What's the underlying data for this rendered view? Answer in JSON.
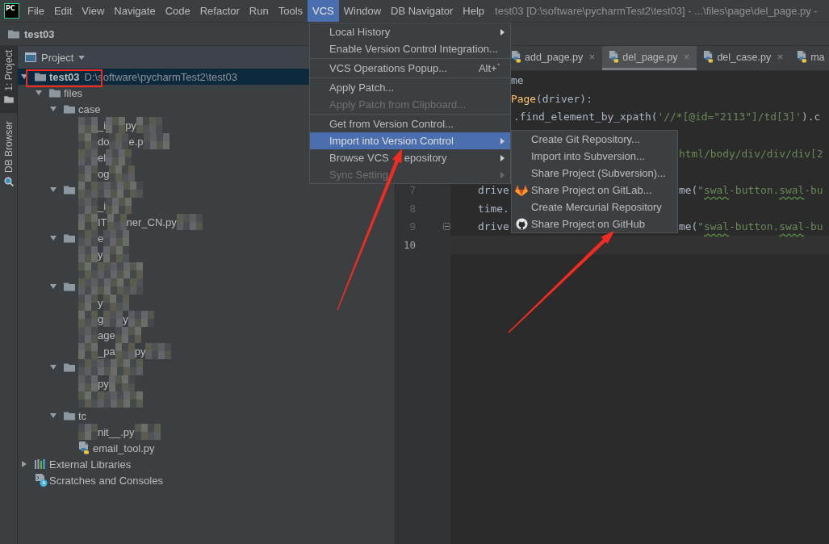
{
  "menu_bar": {
    "logo": "PC",
    "items": [
      {
        "label": "File",
        "selected": false
      },
      {
        "label": "Edit",
        "selected": false
      },
      {
        "label": "View",
        "selected": false
      },
      {
        "label": "Navigate",
        "selected": false
      },
      {
        "label": "Code",
        "selected": false
      },
      {
        "label": "Refactor",
        "selected": false
      },
      {
        "label": "Run",
        "selected": false
      },
      {
        "label": "Tools",
        "selected": false
      },
      {
        "label": "VCS",
        "selected": true
      },
      {
        "label": "Window",
        "selected": false
      },
      {
        "label": "DB Navigator",
        "selected": false
      },
      {
        "label": "Help",
        "selected": false
      }
    ],
    "title": "test03 [D:\\software\\pycharmTest2\\test03] - ...\\files\\page\\del_page.py -"
  },
  "navigation_bar": {
    "crumb": "test03"
  },
  "tool_strip": [
    {
      "label": "1: Project",
      "selected": true
    },
    {
      "label": "DB Browser",
      "selected": false
    }
  ],
  "project_panel": {
    "title": "Project",
    "tree": [
      {
        "kind": "folder",
        "name": "test03",
        "path": "D:\\software\\pycharmTest2\\test03",
        "expanded": true,
        "selected": true,
        "children": [
          {
            "kind": "folder",
            "name": "files",
            "expanded": true,
            "selected": false,
            "children": [
              {
                "kind": "folder",
                "name": "case",
                "expanded": true,
                "selected": false,
                "children": [
                  {
                    "kind": "maskedfile",
                    "fragments": [
                      "_i",
                      "py"
                    ],
                    "selected": false
                  },
                  {
                    "kind": "maskedfile",
                    "fragments": [
                      "do",
                      "e.p"
                    ],
                    "selected": false
                  },
                  {
                    "kind": "maskedfile",
                    "fragments": [
                      "el"
                    ],
                    "selected": false
                  },
                  {
                    "kind": "maskedfile",
                    "fragments": [
                      "og"
                    ],
                    "selected": false
                  }
                ]
              },
              {
                "kind": "maskedfolder",
                "expanded": true,
                "selected": false,
                "children": [
                  {
                    "kind": "maskedfile",
                    "fragments": [
                      "_i"
                    ],
                    "selected": false
                  },
                  {
                    "kind": "maskedfile",
                    "fragments": [
                      "IT",
                      "ner_CN.py"
                    ],
                    "selected": false
                  }
                ]
              },
              {
                "kind": "maskedfolder",
                "fragments": [
                  "e"
                ],
                "expanded": true,
                "selected": false,
                "children": [
                  {
                    "kind": "maskedfile",
                    "fragments": [
                      "y"
                    ],
                    "selected": false
                  },
                  {
                    "kind": "maskedfile",
                    "selected": false
                  }
                ]
              },
              {
                "kind": "maskedfolder",
                "expanded": true,
                "selected": false,
                "children": [
                  {
                    "kind": "maskedfile",
                    "fragments": [
                      "y"
                    ],
                    "selected": false
                  },
                  {
                    "kind": "maskedfile",
                    "fragments": [
                      "g",
                      "y"
                    ],
                    "selected": false
                  },
                  {
                    "kind": "maskedfile",
                    "fragments": [
                      "age"
                    ],
                    "selected": false
                  },
                  {
                    "kind": "maskedfile",
                    "fragments": [
                      "_pa",
                      "py"
                    ],
                    "selected": false
                  }
                ]
              },
              {
                "kind": "maskedfolder",
                "expanded": true,
                "selected": false,
                "children": [
                  {
                    "kind": "maskedfile",
                    "fragments": [
                      "py"
                    ],
                    "selected": false
                  },
                  {
                    "kind": "maskedfile",
                    "selected": false
                  }
                ]
              },
              {
                "kind": "folder",
                "name": "tc",
                "expanded": true,
                "selected": false,
                "children": [
                  {
                    "kind": "maskedfile",
                    "fragments": [
                      "nit__.py"
                    ],
                    "selected": false
                  },
                  {
                    "kind": "file",
                    "name": "email_tool.py",
                    "selected": false
                  }
                ]
              }
            ]
          }
        ]
      },
      {
        "kind": "library",
        "name": "External Libraries",
        "expanded": false,
        "selected": false
      },
      {
        "kind": "scratches",
        "name": "Scratches and Consoles",
        "selected": false
      }
    ]
  },
  "editor": {
    "tabs": [
      {
        "label": "add_page.py",
        "selected": false,
        "close_button": true
      },
      {
        "label": "del_page.py",
        "selected": true,
        "close_button": true
      },
      {
        "label": "del_case.py",
        "selected": false,
        "close_button": true
      },
      {
        "label": "ma",
        "selected": false,
        "close_button": false
      }
    ],
    "code_lines": [
      {
        "parts": [
          [
            {
              "kind": "plain",
              "text": "me"
            }
          ]
        ]
      },
      {
        "parts": [
          [
            {
              "kind": "function",
              "text": "Page"
            },
            {
              "kind": "plain",
              "text": "(driver):"
            }
          ]
        ]
      },
      {
        "parts": [
          [
            {
              "kind": "plain",
              "text": ".find_element_by_xpath("
            },
            {
              "kind": "string",
              "text": "'//*[@id=\"2113\"]/td[3]'"
            },
            {
              "kind": "plain",
              "text": ").c"
            }
          ]
        ]
      },
      {
        "parts": [
          [
            {
              "kind": "string",
              "text": "html/body/div/div/div[2"
            }
          ]
        ]
      },
      {
        "parts": [
          [
            {
              "kind": "plain",
              "text": "drive"
            }
          ],
          [
            {
              "kind": "plain",
              "text": "me("
            },
            {
              "kind": "string",
              "text": "\""
            },
            {
              "kind": "typo",
              "text": "swal"
            },
            {
              "kind": "string",
              "text": "-button."
            },
            {
              "kind": "typo",
              "text": "swal"
            },
            {
              "kind": "string",
              "text": "-bu"
            }
          ]
        ]
      },
      {
        "parts": [
          [
            {
              "kind": "plain",
              "text": "time."
            }
          ]
        ]
      },
      {
        "parts": [
          [
            {
              "kind": "plain",
              "text": "drive"
            }
          ],
          [
            {
              "kind": "plain",
              "text": "me("
            },
            {
              "kind": "string",
              "text": "\""
            },
            {
              "kind": "typo",
              "text": "swal"
            },
            {
              "kind": "string",
              "text": "-button."
            },
            {
              "kind": "typo",
              "text": "swal"
            },
            {
              "kind": "string",
              "text": "-bu"
            }
          ]
        ]
      }
    ],
    "gutter": [
      {
        "number": "7",
        "current": false,
        "fold": false
      },
      {
        "number": "8",
        "current": false,
        "fold": false
      },
      {
        "number": "9",
        "current": false,
        "fold": true
      },
      {
        "number": "10",
        "current": true,
        "fold": false
      }
    ]
  },
  "vcs_menu": {
    "items": [
      {
        "kind": "item",
        "label": "Local History",
        "submenu": true,
        "disabled": false,
        "selected": false
      },
      {
        "kind": "item",
        "label": "Enable Version Control Integration...",
        "submenu": false,
        "disabled": false,
        "selected": false
      },
      {
        "kind": "separator"
      },
      {
        "kind": "item",
        "label": "VCS Operations Popup...",
        "shortcut": "Alt+`",
        "submenu": false,
        "disabled": false,
        "selected": false
      },
      {
        "kind": "separator"
      },
      {
        "kind": "item",
        "label": "Apply Patch...",
        "submenu": false,
        "disabled": false,
        "selected": false
      },
      {
        "kind": "item",
        "label": "Apply Patch from Clipboard...",
        "submenu": false,
        "disabled": true,
        "selected": false
      },
      {
        "kind": "separator"
      },
      {
        "kind": "item",
        "label": "Get from Version Control...",
        "submenu": false,
        "disabled": false,
        "selected": false
      },
      {
        "kind": "item",
        "label": "Import into Version Control",
        "submenu": true,
        "disabled": false,
        "selected": true
      },
      {
        "kind": "item",
        "label": "Browse VCS",
        "label_continued": "epository",
        "submenu": true,
        "disabled": false,
        "selected": false
      },
      {
        "kind": "item",
        "label": "Sync Setting",
        "submenu": true,
        "disabled": true,
        "selected": false
      }
    ]
  },
  "vcs_submenu": {
    "items": [
      {
        "label": "Create Git Repository...",
        "selected": false
      },
      {
        "label": "Import into Subversion...",
        "selected": false
      },
      {
        "label": "Share Project (Subversion)...",
        "selected": false
      },
      {
        "label": "Share Project on GitLab...",
        "selected": false
      },
      {
        "label": "Create Mercurial Repository",
        "selected": false
      },
      {
        "label": "Share Project on GitHub",
        "selected": false
      }
    ]
  },
  "annotations": [
    {
      "kind": "rectangle"
    },
    {
      "kind": "arrow"
    },
    {
      "kind": "arrow"
    }
  ]
}
